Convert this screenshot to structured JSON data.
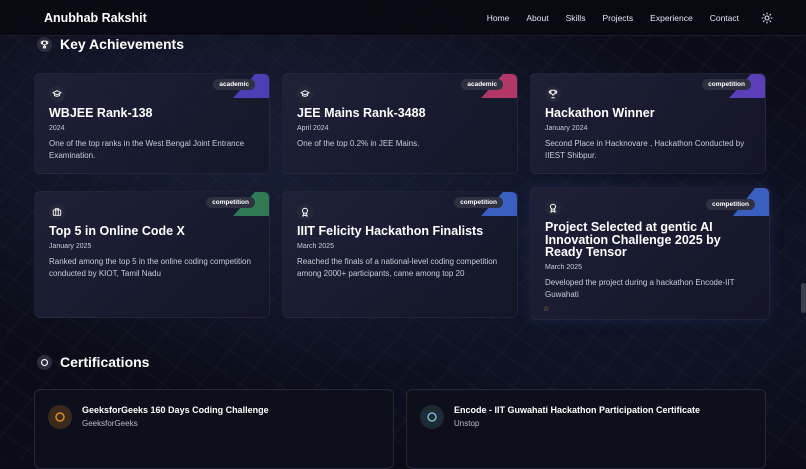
{
  "navbar": {
    "brand": "Anubhab Rakshit",
    "links": [
      "Home",
      "About",
      "Skills",
      "Projects",
      "Experience",
      "Contact"
    ],
    "theme_icon": "sun-icon"
  },
  "achievements": {
    "title": "Key Achievements",
    "title_icon": "trophy-icon",
    "cards": [
      {
        "title": "WBJEE Rank-138",
        "date": "2024",
        "desc": "One of the top ranks in the West Bengal Joint Entrance Examination.",
        "badge": "academic",
        "icon": "graduation-cap-icon",
        "accent": "#4b3fb6"
      },
      {
        "title": "JEE Mains Rank-3488",
        "date": "April 2024",
        "desc": "One of the top 0.2% in JEE Mains.",
        "badge": "academic",
        "icon": "graduation-cap-icon",
        "accent": "#b03766"
      },
      {
        "title": "Hackathon Winner",
        "date": "January 2024",
        "desc": "Second Place in Hacknovare , Hackathon Conducted by IIEST Shibpur.",
        "badge": "competition",
        "icon": "trophy-icon",
        "accent": "#5a3fb8"
      },
      {
        "title": "Top 5 in Online Code X",
        "date": "January 2025",
        "desc": "Ranked among the top 5 in the online coding competition conducted by KIOT, Tamil Nadu",
        "badge": "competition",
        "icon": "briefcase-icon",
        "accent": "#2f7a55"
      },
      {
        "title": "IIIT Felicity Hackathon Finalists",
        "date": "March 2025",
        "desc": "Reached the finals of a national-level coding competition among 2000+ participants, came among top 20",
        "badge": "competition",
        "icon": "award-icon",
        "accent": "#3a5fc0"
      },
      {
        "title": "Project Selected at gentic AI Innovation Challenge 2025 by Ready Tensor",
        "date": "March 2025",
        "desc": "Developed the project during a hackathon Encode-IIT Guwahati",
        "badge": "competition",
        "icon": "award-icon",
        "accent": "#3a5fc0"
      }
    ]
  },
  "certifications": {
    "title": "Certifications",
    "title_icon": "circle-icon",
    "items": [
      {
        "title": "GeeksforGeeks 160 Days Coding Challenge",
        "issuer": "GeeksforGeeks",
        "icon": "circle-icon",
        "accent": "#e08a2a"
      },
      {
        "title": "Encode - IIT Guwahati Hackathon Participation Certificate",
        "issuer": "Unstop",
        "icon": "circle-icon",
        "accent": "#7ab3d0"
      }
    ]
  }
}
